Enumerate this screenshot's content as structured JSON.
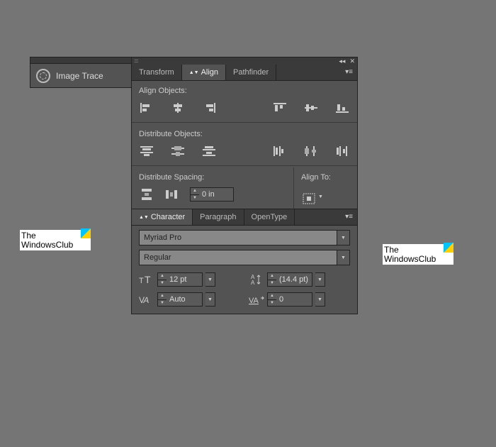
{
  "mini_panel": {
    "label": "Image Trace"
  },
  "tabs1": {
    "transform": "Transform",
    "align": "Align",
    "pathfinder": "Pathfinder"
  },
  "align": {
    "objects_label": "Align Objects:",
    "distribute_label": "Distribute Objects:",
    "spacing_label": "Distribute Spacing:",
    "align_to_label": "Align To:",
    "spacing_value": "0 in"
  },
  "tabs2": {
    "character": "Character",
    "paragraph": "Paragraph",
    "opentype": "OpenType"
  },
  "character": {
    "font_family": "Myriad Pro",
    "font_style": "Regular",
    "size": "12 pt",
    "leading": "(14.4 pt)",
    "kerning": "Auto",
    "tracking": "0"
  },
  "watermark": {
    "line1": "The",
    "line2": "WindowsClub"
  }
}
